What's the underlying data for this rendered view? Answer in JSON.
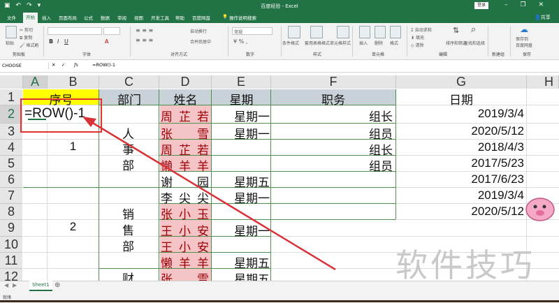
{
  "title_bar": {
    "doc_title": "百度经验 - Excel",
    "login_label": "登录",
    "undo_icon": "undo-icon",
    "redo_icon": "redo-icon",
    "save_icon": "save-icon"
  },
  "ribbon_tabs": [
    "文件",
    "开始",
    "插入",
    "页面布局",
    "公式",
    "数据",
    "审阅",
    "视图",
    "开发工具",
    "帮助",
    "百度网盘"
  ],
  "active_tab": "开始",
  "tell_me": "操作说明搜索",
  "share_label": "共享",
  "ribbon": {
    "clipboard": {
      "paste": "粘贴",
      "cut": "剪切",
      "copy": "复制",
      "format_painter": "格式刷",
      "label": "剪贴板"
    },
    "font_label": "字体",
    "alignment": {
      "wrap": "自动换行",
      "merge": "合并后居中",
      "label": "对齐方式"
    },
    "number": {
      "format": "常规",
      "label": "数字"
    },
    "styles": {
      "conditional": "条件格式",
      "table": "套用表格格式",
      "cell": "单元格样式",
      "label": "样式"
    },
    "cells": {
      "insert": "插入",
      "delete": "删除",
      "format": "格式",
      "label": "单元格"
    },
    "editing": {
      "autosum": "自动求和",
      "fill": "填充",
      "clear": "清除",
      "sort": "排序和筛选",
      "find": "查找和选择",
      "label": "编辑"
    },
    "new_group": {
      "label": "新建组"
    },
    "save": {
      "line1": "保存到",
      "line2": "百度网盘",
      "label": "保存"
    }
  },
  "formula_bar": {
    "name_box": "CHOOSE",
    "fx": "fx",
    "formula": "=ROW()-1"
  },
  "columns": [
    "A",
    "B",
    "C",
    "D",
    "E",
    "F",
    "G",
    "H"
  ],
  "rows": [
    "1",
    "2",
    "3",
    "4",
    "5",
    "6",
    "7",
    "8",
    "9",
    "10",
    "11",
    "12"
  ],
  "headers": {
    "seq": "序号",
    "dept": "部门",
    "name": "姓名",
    "weekday": "星期",
    "duty": "职务",
    "date": "日期"
  },
  "editing_cell": "=ROW()-1",
  "seq_values": {
    "g1": "1",
    "g2": "2"
  },
  "depts": {
    "d1": [
      "人",
      "事",
      "部"
    ],
    "d2": [
      "销",
      "售",
      "部"
    ],
    "d3": "财"
  },
  "names": [
    [
      "周",
      "芷",
      "若"
    ],
    [
      "张",
      "",
      "雪"
    ],
    [
      "周",
      "芷",
      "若"
    ],
    [
      "懒",
      "羊",
      "羊"
    ],
    [
      "谢",
      "",
      "园"
    ],
    [
      "李",
      "尖",
      "尖"
    ],
    [
      "张",
      "小",
      "玉"
    ],
    [
      "王",
      "小",
      "安"
    ],
    [
      "王",
      "小",
      "安"
    ],
    [
      "懒",
      "羊",
      "羊"
    ],
    [
      "张",
      "",
      "雪"
    ]
  ],
  "weekdays": [
    "星期一",
    "星期一",
    "",
    "",
    "星期五",
    "星期一",
    "",
    "星期一",
    "",
    "星期五",
    "星期五"
  ],
  "duties": [
    "组长",
    "组员",
    "组长",
    "组员"
  ],
  "dates": [
    "2019/3/4",
    "2020/5/12",
    "2018/4/3",
    "2017/5/23",
    "2017/6/23",
    "2019/3/4",
    "2020/5/12"
  ],
  "sheet_tab": "Sheet1",
  "status": "就绪",
  "watermark": "软件技巧",
  "colors": {
    "accent": "#217346",
    "header_fill": "#ffff00",
    "pink_fill": "#f5c4c6",
    "red_box": "#e53030",
    "arrow": "#d9333a"
  }
}
